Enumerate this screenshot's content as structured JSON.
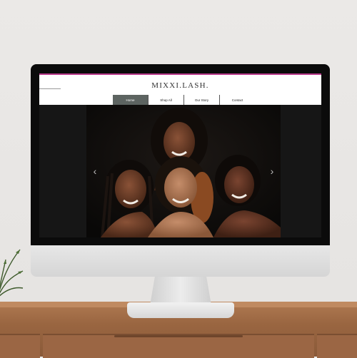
{
  "site": {
    "logo": "MIXXI.LASH.",
    "nav": [
      "Home",
      "Shop All",
      "Our Story",
      "Contact"
    ],
    "active_nav": "Home",
    "brand_accent": "#b8398b",
    "active_nav_color": "#5d6461"
  },
  "slider": {
    "prev_icon": "chevron-left-icon",
    "next_icon": "chevron-right-icon",
    "prev_glyph": "‹",
    "next_glyph": "›"
  }
}
